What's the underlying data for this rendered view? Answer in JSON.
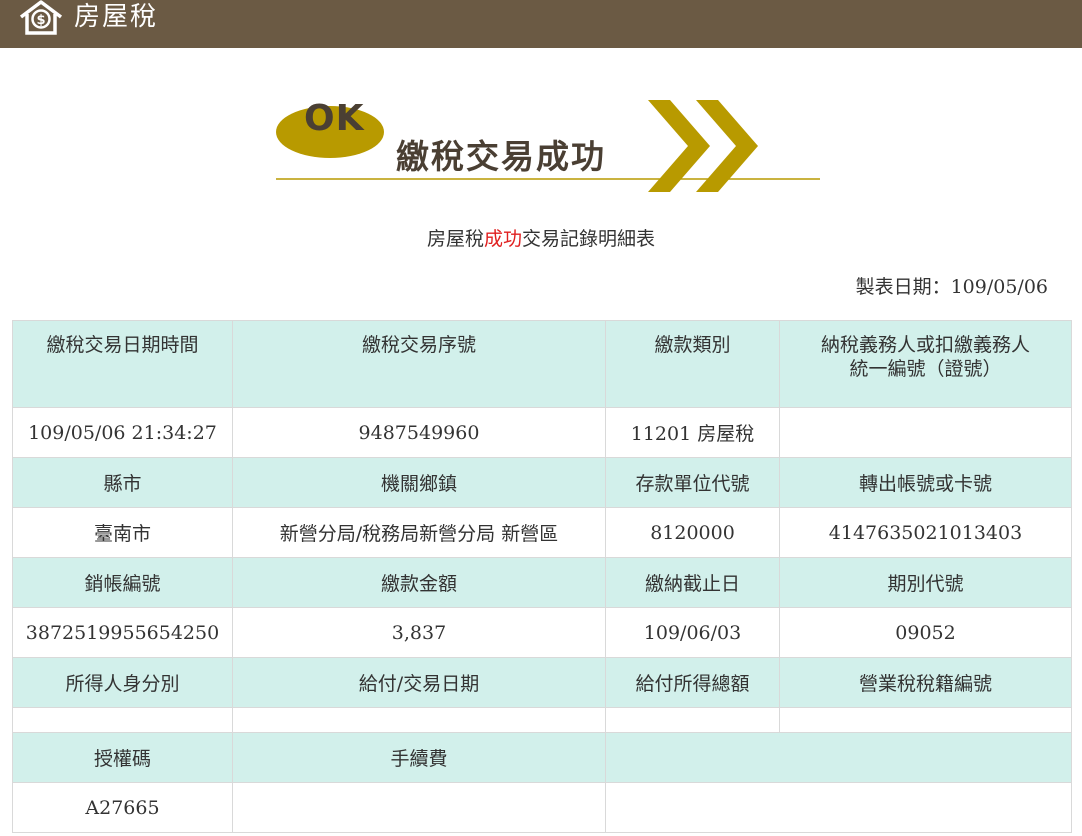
{
  "header": {
    "title": "房屋稅",
    "icon": "house-dollar-icon"
  },
  "banner": {
    "ok": "OK",
    "message": "繳稅交易成功"
  },
  "report": {
    "title_prefix": "房屋稅",
    "title_highlight": "成功",
    "title_suffix": "交易記錄明細表",
    "date": "製表日期：109/05/06"
  },
  "table": {
    "row1": {
      "h1": "繳稅交易日期時間",
      "h2": "繳稅交易序號",
      "h3": "繳款類別",
      "h4_line1": "納稅義務人或扣繳義務人",
      "h4_line2": "統一編號（證號）",
      "v1": "109/05/06 21:34:27",
      "v2": "9487549960",
      "v3": "11201 房屋稅",
      "v4": ""
    },
    "row2": {
      "h1": "縣市",
      "h2": "機關鄉鎮",
      "h3": "存款單位代號",
      "h4": "轉出帳號或卡號",
      "v1": "臺南市",
      "v2": "新營分局/稅務局新營分局 新營區",
      "v3": "8120000",
      "v4": "4147635021013403"
    },
    "row3": {
      "h1": "銷帳編號",
      "h2": "繳款金額",
      "h3": "繳納截止日",
      "h4": "期別代號",
      "v1": "3872519955654250",
      "v2": "3,837",
      "v3": "109/06/03",
      "v4": "09052"
    },
    "row4": {
      "h1": "所得人身分別",
      "h2": "給付/交易日期",
      "h3": "給付所得總額",
      "h4": "營業稅稅籍編號",
      "v1": "",
      "v2": "",
      "v3": "",
      "v4": ""
    },
    "row5": {
      "h1": "授權碼",
      "h2": "手續費",
      "v1": "A27665",
      "v2": ""
    }
  },
  "colors": {
    "header_bg": "#6b5a44",
    "cell_header_bg": "#d2f0eb",
    "accent_gold": "#b89a00",
    "highlight_red": "#e02020"
  }
}
